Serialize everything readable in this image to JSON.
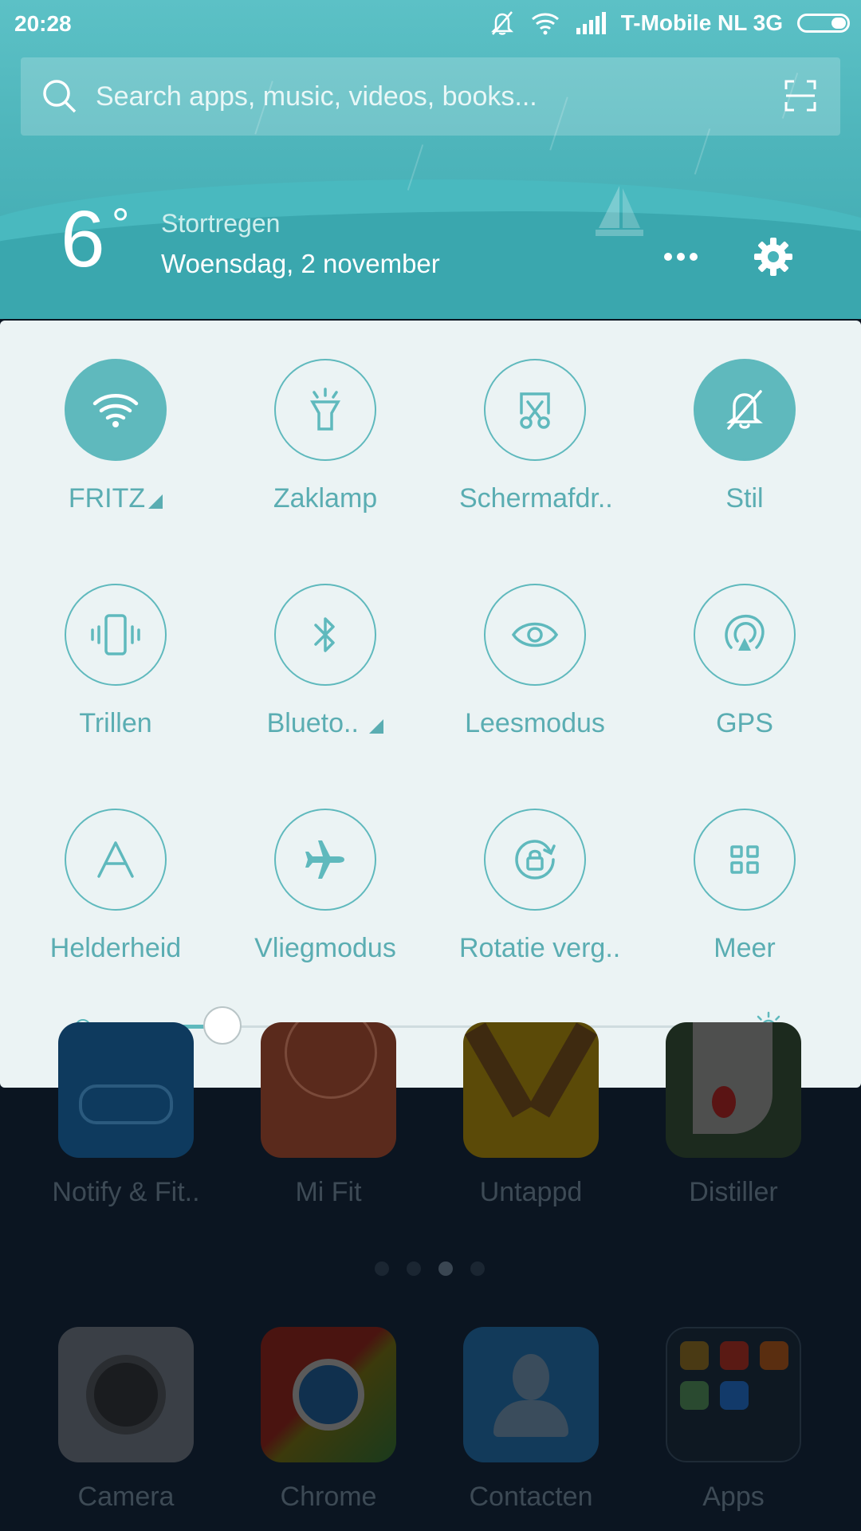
{
  "status_bar": {
    "time": "20:28",
    "carrier": "T-Mobile  NL 3G",
    "icons": [
      "bell-off-icon",
      "wifi-icon",
      "signal-icon",
      "battery-icon"
    ]
  },
  "search": {
    "placeholder": "Search apps, music, videos, books..."
  },
  "weather": {
    "temperature": "6",
    "degree": "°",
    "condition": "Stortregen",
    "date": "Woensdag, 2 november"
  },
  "quick_settings": {
    "tiles": [
      {
        "label": "FRITZ",
        "icon": "wifi-icon",
        "active": true,
        "expandable": true
      },
      {
        "label": "Zaklamp",
        "icon": "flashlight-icon",
        "active": false
      },
      {
        "label": "Schermafdr..",
        "icon": "screenshot-icon",
        "active": false
      },
      {
        "label": "Stil",
        "icon": "bell-off-icon",
        "active": true
      },
      {
        "label": "Trillen",
        "icon": "vibrate-icon",
        "active": false
      },
      {
        "label": "Blueto..",
        "icon": "bluetooth-icon",
        "active": false,
        "expandable": true
      },
      {
        "label": "Leesmodus",
        "icon": "eye-icon",
        "active": false
      },
      {
        "label": "GPS",
        "icon": "gps-icon",
        "active": false
      },
      {
        "label": "Helderheid",
        "icon": "auto-brightness-icon",
        "active": false
      },
      {
        "label": "Vliegmodus",
        "icon": "airplane-icon",
        "active": false
      },
      {
        "label": "Rotatie verg..",
        "icon": "rotation-lock-icon",
        "active": false
      },
      {
        "label": "Meer",
        "icon": "grid-icon",
        "active": false
      }
    ],
    "brightness_level": 0.18
  },
  "home": {
    "row1": [
      {
        "name": "Notify & Fit..",
        "color": "#0e3a5e"
      },
      {
        "name": "Mi Fit",
        "color": "#5a2a1c"
      },
      {
        "name": "Untappd",
        "color": "#5b4a08"
      },
      {
        "name": "Distiller",
        "color": "#1c2a1e"
      }
    ],
    "dock": [
      {
        "name": "Camera",
        "color": "#3a3f46"
      },
      {
        "name": "Chrome",
        "color": "#3a2e16"
      },
      {
        "name": "Contacten",
        "color": "#123a5a"
      },
      {
        "name": "Apps",
        "color": "#0e1822"
      }
    ],
    "page_indicator": {
      "count": 4,
      "active": 3
    }
  }
}
